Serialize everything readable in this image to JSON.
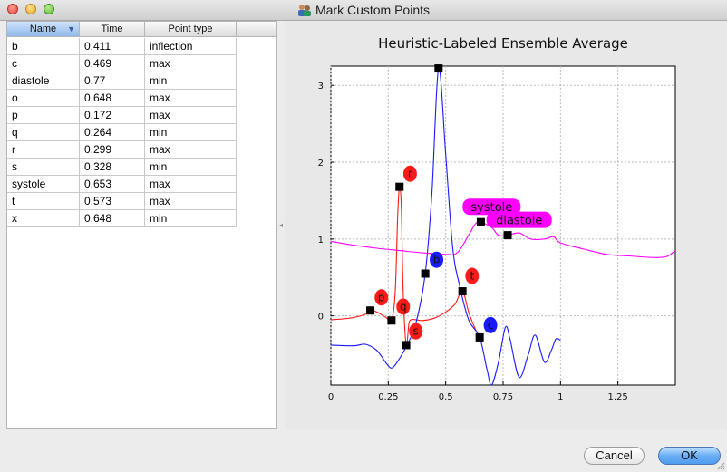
{
  "window": {
    "title": "Mark Custom Points"
  },
  "table": {
    "columns": [
      "Name",
      "Time",
      "Point type"
    ],
    "rows": [
      {
        "name": "b",
        "time": "0.411",
        "type": "inflection"
      },
      {
        "name": "c",
        "time": "0.469",
        "type": "max"
      },
      {
        "name": "diastole",
        "time": "0.77",
        "type": "min"
      },
      {
        "name": "o",
        "time": "0.648",
        "type": "max"
      },
      {
        "name": "p",
        "time": "0.172",
        "type": "max"
      },
      {
        "name": "q",
        "time": "0.264",
        "type": "min"
      },
      {
        "name": "r",
        "time": "0.299",
        "type": "max"
      },
      {
        "name": "s",
        "time": "0.328",
        "type": "min"
      },
      {
        "name": "systole",
        "time": "0.653",
        "type": "max"
      },
      {
        "name": "t",
        "time": "0.573",
        "type": "max"
      },
      {
        "name": "x",
        "time": "0.648",
        "type": "min"
      }
    ]
  },
  "buttons": {
    "cancel": "Cancel",
    "ok": "OK"
  },
  "colors": {
    "ecg": "#ff1a1a",
    "icg": "#1a1aff",
    "bp": "#ff00ff",
    "marker": "#000000"
  },
  "chart_data": {
    "type": "line",
    "title": "Heuristic-Labeled Ensemble Average",
    "xlabel": "",
    "ylabel": "",
    "xlim": [
      0,
      1.5
    ],
    "ylim": [
      -0.9,
      3.25
    ],
    "xticks": [
      "0",
      "0.25",
      "0.5",
      "0.75",
      "1",
      "1.25"
    ],
    "yticks": [
      "0",
      "1",
      "2",
      "3"
    ],
    "grid": true,
    "series": [
      {
        "color_key": "ecg",
        "points": [
          [
            0,
            -0.05
          ],
          [
            0.05,
            -0.04
          ],
          [
            0.1,
            -0.02
          ],
          [
            0.15,
            0.02
          ],
          [
            0.172,
            0.07
          ],
          [
            0.2,
            0.05
          ],
          [
            0.24,
            -0.02
          ],
          [
            0.264,
            -0.06
          ],
          [
            0.28,
            0.3
          ],
          [
            0.291,
            1.3
          ],
          [
            0.299,
            1.68
          ],
          [
            0.307,
            1.4
          ],
          [
            0.315,
            0.3
          ],
          [
            0.328,
            -0.38
          ],
          [
            0.34,
            -0.1
          ],
          [
            0.35,
            -0.05
          ],
          [
            0.37,
            -0.05
          ],
          [
            0.4,
            -0.06
          ],
          [
            0.45,
            -0.03
          ],
          [
            0.5,
            0.05
          ],
          [
            0.54,
            0.15
          ],
          [
            0.573,
            0.32
          ],
          [
            0.6,
            0.05
          ],
          [
            0.63,
            -0.18
          ],
          [
            0.648,
            -0.28
          ]
        ]
      },
      {
        "color_key": "icg",
        "points": [
          [
            0,
            -0.38
          ],
          [
            0.1,
            -0.39
          ],
          [
            0.15,
            -0.37
          ],
          [
            0.2,
            -0.45
          ],
          [
            0.25,
            -0.65
          ],
          [
            0.27,
            -0.67
          ],
          [
            0.3,
            -0.55
          ],
          [
            0.328,
            -0.4
          ],
          [
            0.37,
            -0.1
          ],
          [
            0.411,
            0.55
          ],
          [
            0.44,
            1.6
          ],
          [
            0.469,
            3.22
          ],
          [
            0.5,
            2.1
          ],
          [
            0.53,
            0.9
          ],
          [
            0.56,
            0.4
          ],
          [
            0.6,
            -0.05
          ],
          [
            0.648,
            -0.28
          ],
          [
            0.68,
            -0.7
          ],
          [
            0.7,
            -0.9
          ],
          [
            0.73,
            -0.6
          ],
          [
            0.76,
            -0.15
          ],
          [
            0.78,
            -0.3
          ],
          [
            0.82,
            -0.8
          ],
          [
            0.86,
            -0.5
          ],
          [
            0.89,
            -0.25
          ],
          [
            0.93,
            -0.6
          ],
          [
            0.96,
            -0.45
          ],
          [
            0.98,
            -0.3
          ],
          [
            1.0,
            -0.32
          ]
        ]
      },
      {
        "color_key": "bp",
        "points": [
          [
            0,
            0.97
          ],
          [
            0.1,
            0.92
          ],
          [
            0.2,
            0.88
          ],
          [
            0.3,
            0.85
          ],
          [
            0.4,
            0.82
          ],
          [
            0.5,
            0.8
          ],
          [
            0.55,
            0.82
          ],
          [
            0.6,
            1.05
          ],
          [
            0.63,
            1.2
          ],
          [
            0.653,
            1.22
          ],
          [
            0.7,
            1.15
          ],
          [
            0.73,
            1.05
          ],
          [
            0.77,
            1.05
          ],
          [
            0.82,
            1.08
          ],
          [
            0.87,
            1.0
          ],
          [
            0.93,
            1.0
          ],
          [
            0.97,
            1.03
          ],
          [
            1.0,
            0.95
          ],
          [
            1.1,
            0.87
          ],
          [
            1.2,
            0.8
          ],
          [
            1.3,
            0.78
          ],
          [
            1.4,
            0.76
          ],
          [
            1.46,
            0.77
          ],
          [
            1.5,
            0.85
          ]
        ]
      }
    ],
    "markers": [
      [
        0.172,
        0.07
      ],
      [
        0.264,
        -0.06
      ],
      [
        0.299,
        1.68
      ],
      [
        0.328,
        -0.38
      ],
      [
        0.411,
        0.55
      ],
      [
        0.469,
        3.22
      ],
      [
        0.573,
        0.32
      ],
      [
        0.648,
        -0.28
      ],
      [
        0.653,
        1.22
      ],
      [
        0.77,
        1.05
      ]
    ],
    "annotations": [
      {
        "label": "p",
        "x": 0.22,
        "y": 0.24,
        "color_key": "ecg"
      },
      {
        "label": "r",
        "x": 0.345,
        "y": 1.85,
        "color_key": "ecg"
      },
      {
        "label": "q",
        "x": 0.315,
        "y": 0.12,
        "color_key": "ecg"
      },
      {
        "label": "s",
        "x": 0.37,
        "y": -0.2,
        "color_key": "ecg"
      },
      {
        "label": "b",
        "x": 0.46,
        "y": 0.73,
        "color_key": "icg"
      },
      {
        "label": "t",
        "x": 0.615,
        "y": 0.52,
        "color_key": "ecg"
      },
      {
        "label": "c",
        "x": 0.695,
        "y": -0.12,
        "color_key": "icg"
      },
      {
        "label": "systole",
        "x": 0.7,
        "y": 1.42,
        "color_key": "bp"
      },
      {
        "label": "diastole",
        "x": 0.82,
        "y": 1.25,
        "color_key": "bp"
      }
    ]
  }
}
